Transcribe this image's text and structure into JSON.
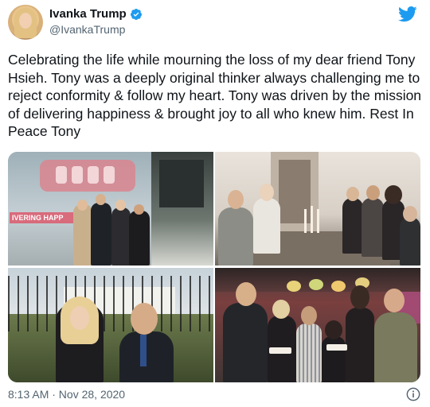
{
  "user": {
    "display_name": "Ivanka Trump",
    "handle": "@IvankaTrump"
  },
  "icons": {
    "verified": "verified-badge-icon",
    "platform": "twitter-bird-icon",
    "info": "info-icon"
  },
  "colors": {
    "twitter_blue": "#1d9bf0",
    "secondary_text": "#536471",
    "primary_text": "#0f1419"
  },
  "tweet": {
    "text": "Celebrating the life while mourning the loss of my dear friend Tony Hsieh. Tony was a deeply original thinker always challenging me to reject conformity & follow my heart. Tony was driven by the mission of delivering happiness & brought joy to all who knew him. Rest In Peace Tony",
    "timestamp": "8:13 AM · Nov 28, 2020"
  },
  "media": {
    "photo1_bus_text": "IVERING HAPP"
  }
}
